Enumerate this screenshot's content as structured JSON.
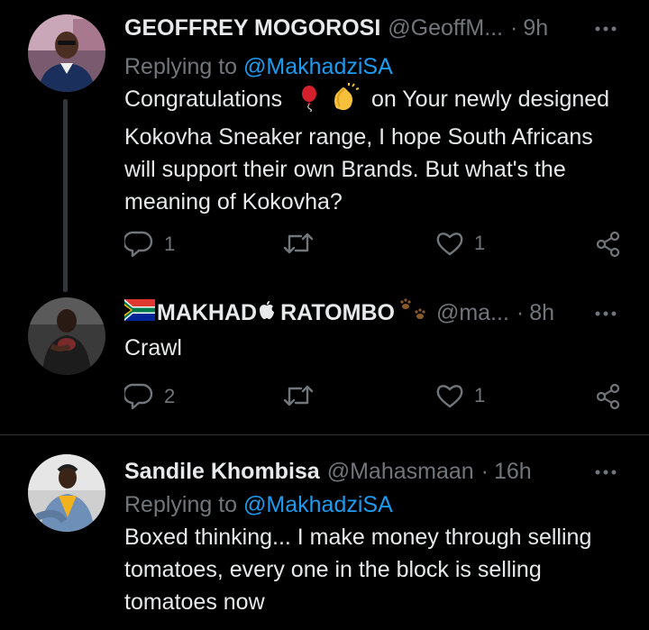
{
  "tweets": [
    {
      "name": "GEOFFREY MOGOROSI",
      "handle": "@GeoffM...",
      "separator": "·",
      "time": "9h",
      "reply_prefix": "Replying to",
      "reply_mention": "@MakhadziSA",
      "text_line1_a": "Congratulations",
      "text_line1_b": "on Your newly designed",
      "text_rest": "Kokovha Sneaker range, I hope South Africans will support their own Brands. But what's the meaning of Kokovha?",
      "replies": "1",
      "retweets": "",
      "likes": "1"
    },
    {
      "name_a": "MAKHAD",
      "name_b": "RATOMBO",
      "handle": "@ma...",
      "separator": "·",
      "time": "8h",
      "text": "Crawl",
      "replies": "2",
      "retweets": "",
      "likes": "1"
    },
    {
      "name": "Sandile Khombisa",
      "handle": "@Mahasmaan",
      "separator": "·",
      "time": "16h",
      "reply_prefix": "Replying to",
      "reply_mention": "@MakhadziSA",
      "text": "Boxed thinking... I make money through selling tomatoes, every one in the block is selling tomatoes now"
    }
  ],
  "colors": {
    "background": "#000000",
    "text_primary": "#e7e9ea",
    "text_secondary": "#71767b",
    "accent": "#1d9bf0",
    "divider": "#2f3336"
  },
  "icons": {
    "reply": "reply-icon",
    "retweet": "retweet-icon",
    "like": "heart-icon",
    "share": "share-icon",
    "more": "more-icon"
  }
}
